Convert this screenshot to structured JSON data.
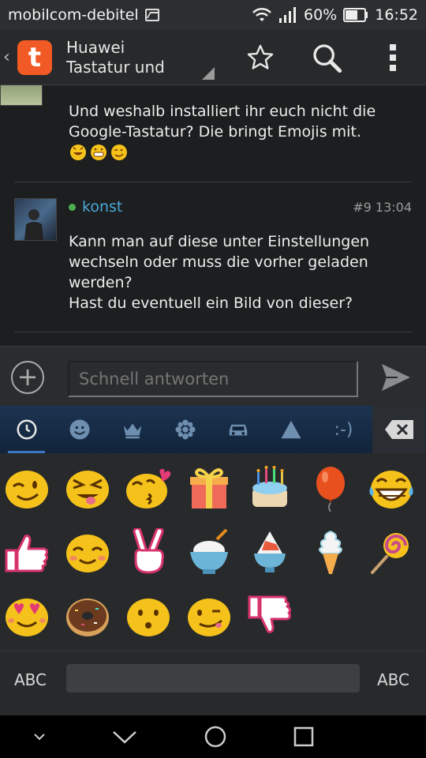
{
  "status": {
    "carrier": "mobilcom-debitel",
    "battery": "60%",
    "time": "16:52"
  },
  "appbar": {
    "logo_letter": "t",
    "title_line1": "Huawei",
    "title_line2": "Tastatur und"
  },
  "posts": [
    {
      "text": "Und weshalb installiert ihr euch nicht die\nGoogle-Tastatur? Die bringt Emojis mit."
    },
    {
      "user": "konst",
      "post_number": "#9",
      "time": "13:04",
      "text": "Kann man auf diese unter Einstellungen\nwechseln oder muss die vorher geladen\nwerden?\nHast du eventuell ein Bild von dieser?"
    }
  ],
  "reply": {
    "placeholder": "Schnell antworten"
  },
  "keyboard": {
    "tab_text_emoticon": ":-)",
    "abc_left": "ABC",
    "abc_right": "ABC"
  }
}
